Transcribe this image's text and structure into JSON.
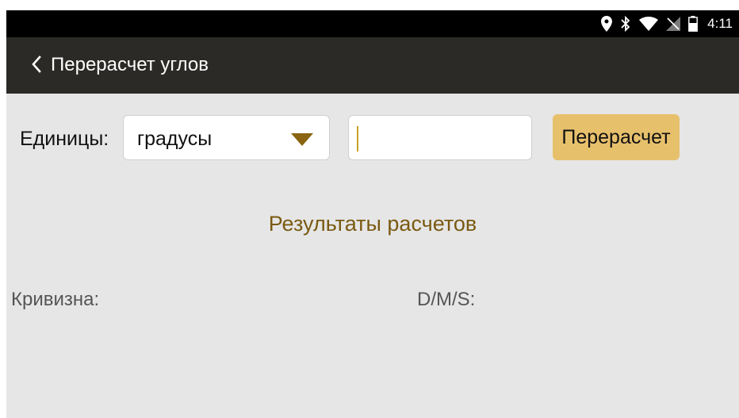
{
  "status_bar": {
    "time": "4:11",
    "icons": [
      "location-icon",
      "bluetooth-icon",
      "wifi-icon",
      "no-signal-icon",
      "battery-icon"
    ]
  },
  "app_bar": {
    "title": "Перерасчет углов",
    "back_icon": "chevron-left-icon"
  },
  "form": {
    "units_label": "Единицы:",
    "units_value": "градусы",
    "angle_input_value": "",
    "angle_input_placeholder": "",
    "recalc_label": "Перерасчет"
  },
  "results": {
    "heading": "Результаты расчетов",
    "curvature_label": "Кривизна:",
    "dms_label": "D/M/S:"
  },
  "colors": {
    "app_bar_bg": "#2b2a27",
    "screen_bg": "#e6e6e6",
    "accent_button": "#e7c06c",
    "heading_text": "#7a5a12",
    "dropdown_arrow": "#8a6410"
  }
}
